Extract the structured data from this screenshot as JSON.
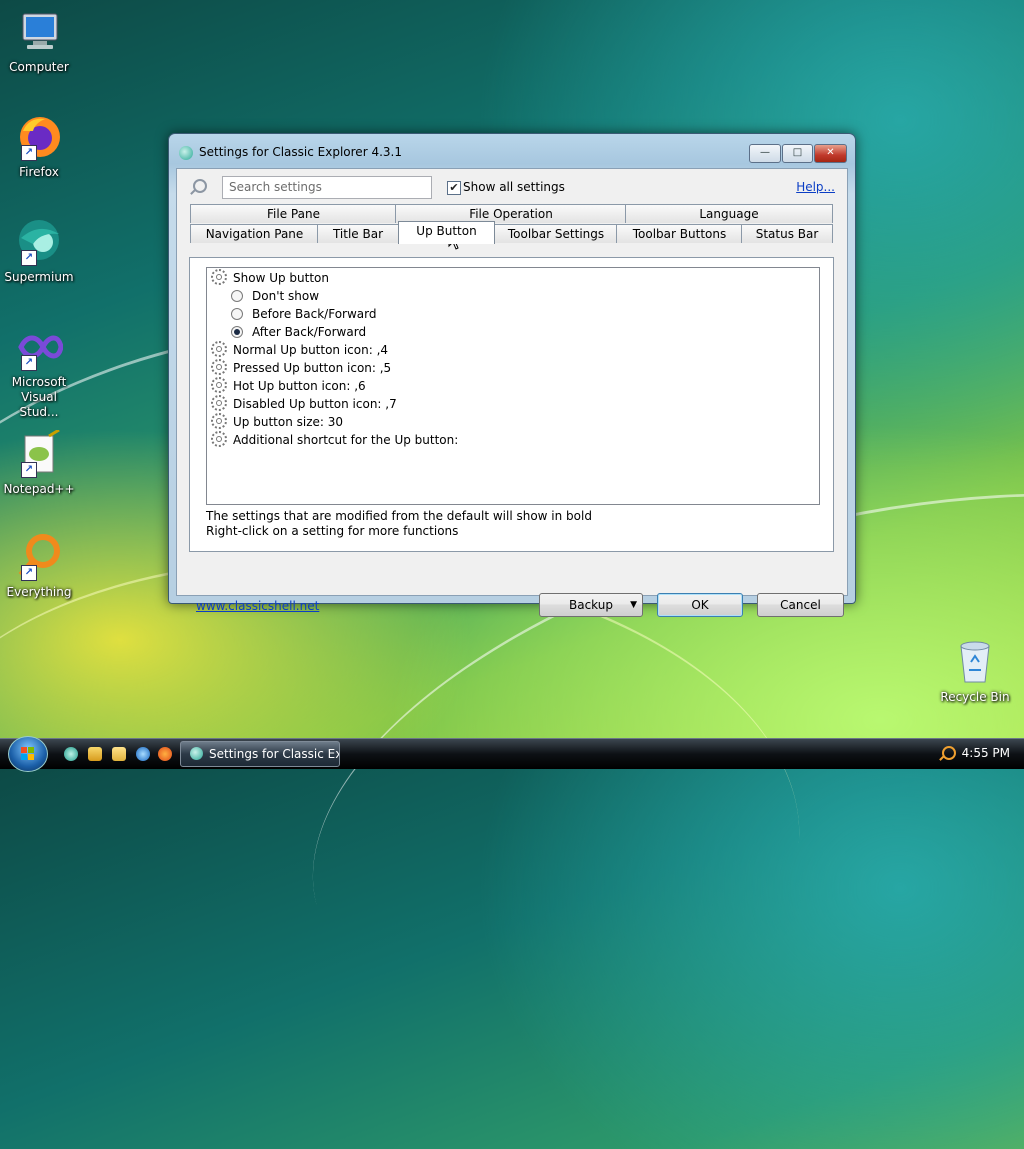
{
  "desktop": {
    "icons": [
      {
        "label": "Computer",
        "icon": "computer-icon"
      },
      {
        "label": "Firefox",
        "icon": "firefox-icon"
      },
      {
        "label": "Supermium",
        "icon": "supermium-icon"
      },
      {
        "label": "Microsoft Visual Stud...",
        "icon": "visual-studio-icon"
      },
      {
        "label": "Notepad++",
        "icon": "notepad-plus-plus-icon"
      },
      {
        "label": "Everything",
        "icon": "everything-icon"
      },
      {
        "label": "Recycle Bin",
        "icon": "recycle-bin-icon"
      }
    ]
  },
  "window": {
    "title": "Settings for Classic Explorer 4.3.1",
    "controls": {
      "minimize": "—",
      "maximize": "□",
      "close": "✕"
    }
  },
  "toolbar": {
    "search_placeholder": "Search settings",
    "show_all_label": "Show all settings",
    "show_all_checked": true,
    "show_all_mark": "✔",
    "help_label": "Help..."
  },
  "tabs": {
    "row1": [
      "File Pane",
      "File Operation",
      "Language"
    ],
    "row2": [
      "Navigation Pane",
      "Title Bar",
      "Up Button",
      "Toolbar Settings",
      "Toolbar Buttons",
      "Status Bar"
    ],
    "active": "Up Button"
  },
  "settings": [
    {
      "type": "setting",
      "label": "Show Up button"
    },
    {
      "type": "option",
      "label": "Don't show",
      "checked": false
    },
    {
      "type": "option",
      "label": "Before Back/Forward",
      "checked": false
    },
    {
      "type": "option",
      "label": "After Back/Forward",
      "checked": true
    },
    {
      "type": "setting",
      "label": "Normal Up button icon: ,4"
    },
    {
      "type": "setting",
      "label": "Pressed Up button icon: ,5"
    },
    {
      "type": "setting",
      "label": "Hot Up button icon: ,6"
    },
    {
      "type": "setting",
      "label": "Disabled Up button icon: ,7"
    },
    {
      "type": "setting",
      "label": "Up button size: 30"
    },
    {
      "type": "setting",
      "label": "Additional shortcut for the Up button:"
    }
  ],
  "hints": {
    "line1": "The settings that are modified from the default will show in bold",
    "line2": "Right-click on a setting for more functions"
  },
  "footer": {
    "website_link": "www.classicshell.net",
    "backup_label": "Backup",
    "backup_arrow": "▼",
    "ok_label": "OK",
    "cancel_label": "Cancel"
  },
  "taskbar": {
    "active_window_label": "Settings for Classic Ex...",
    "clock": "4:55 PM",
    "quick_launch": [
      "supermium-icon",
      "media-icon",
      "folder-icon",
      "internet-explorer-icon",
      "firefox-icon"
    ]
  }
}
